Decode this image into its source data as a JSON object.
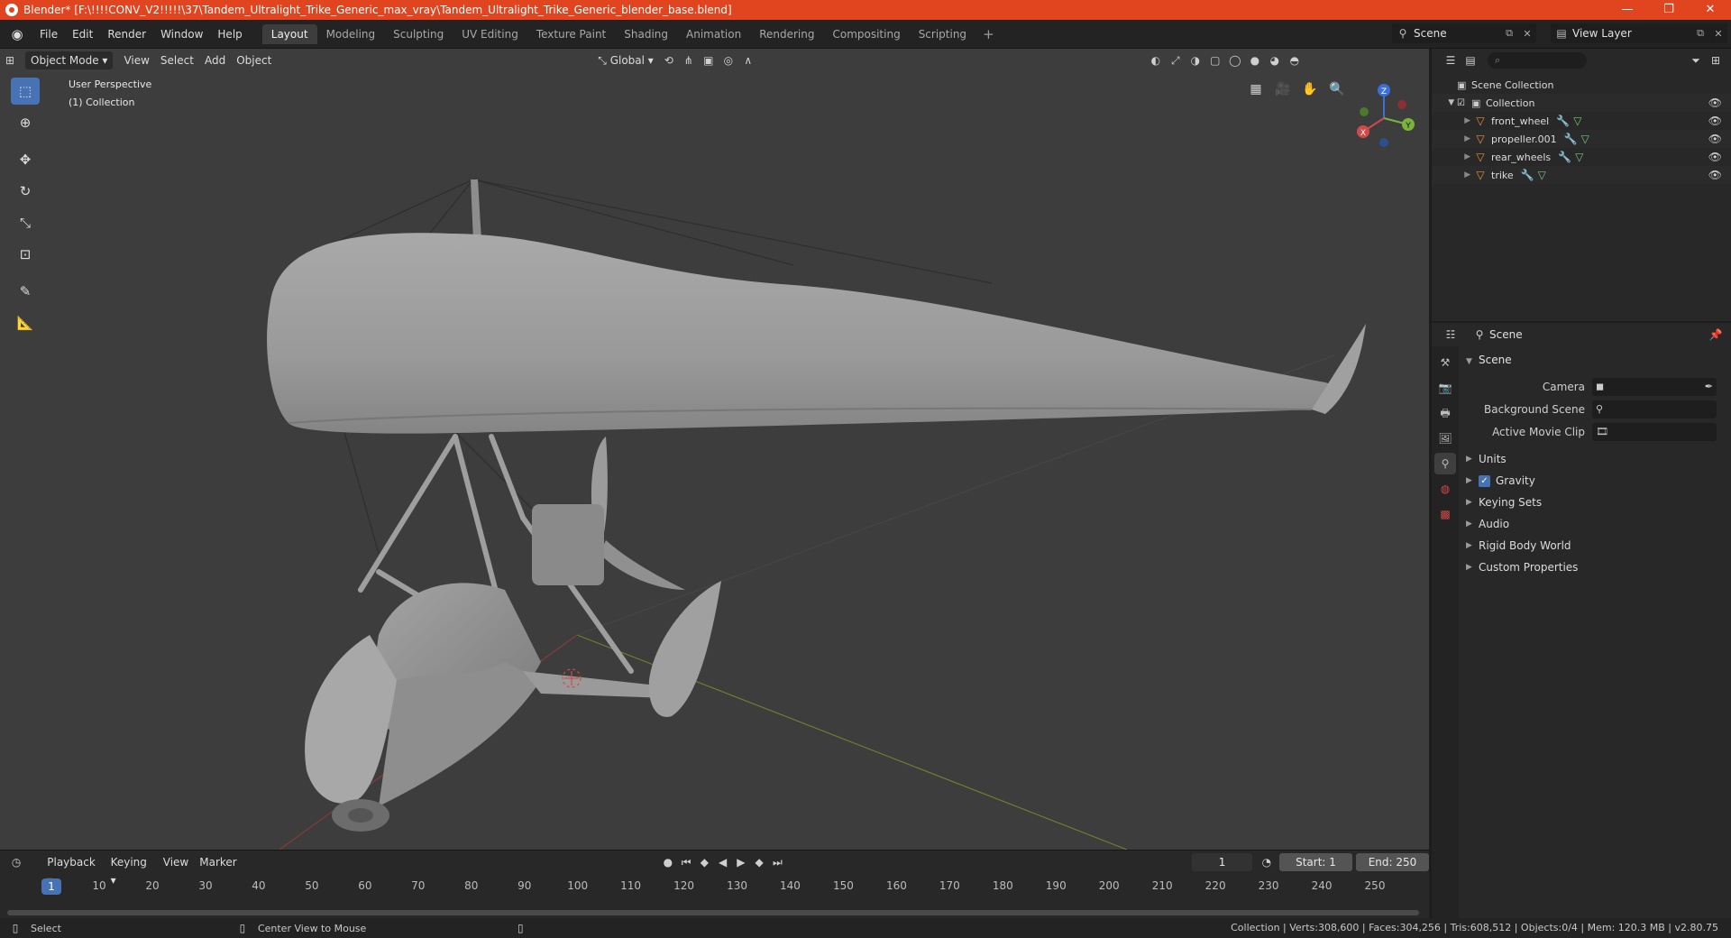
{
  "window": {
    "title": "Blender* [F:\\!!!!CONV_V2!!!!!\\37\\Tandem_Ultralight_Trike_Generic_max_vray\\Tandem_Ultralight_Trike_Generic_blender_base.blend]",
    "controls": [
      "—",
      "❐",
      "✕"
    ]
  },
  "menu": [
    "File",
    "Edit",
    "Render",
    "Window",
    "Help"
  ],
  "workspaces": [
    "Layout",
    "Modeling",
    "Sculpting",
    "UV Editing",
    "Texture Paint",
    "Shading",
    "Animation",
    "Rendering",
    "Compositing",
    "Scripting"
  ],
  "active_workspace": "Layout",
  "scene_name": "Scene",
  "view_layer": "View Layer",
  "viewport": {
    "mode": "Object Mode",
    "menus": [
      "View",
      "Select",
      "Add",
      "Object"
    ],
    "orientation": "Global",
    "info_line1": "User Perspective",
    "info_line2": "(1) Collection",
    "axes": {
      "x": "X",
      "y": "Y",
      "z": "Z"
    }
  },
  "outliner": {
    "root": "Scene Collection",
    "collection": "Collection",
    "objects": [
      "front_wheel",
      "propeller.001",
      "rear_wheels",
      "trike"
    ]
  },
  "properties": {
    "context": "Scene",
    "panel": "Scene",
    "camera_label": "Camera",
    "background_label": "Background Scene",
    "movieclip_label": "Active Movie Clip",
    "subpanels": [
      "Units",
      "Gravity",
      "Keying Sets",
      "Audio",
      "Rigid Body World",
      "Custom Properties"
    ]
  },
  "timeline": {
    "menus": [
      "Playback",
      "Keying",
      "View",
      "Marker"
    ],
    "current_frame": "1",
    "start_label": "Start:",
    "start": "1",
    "end_label": "End:",
    "end": "250",
    "ticks": [
      "10",
      "20",
      "30",
      "40",
      "50",
      "60",
      "70",
      "80",
      "90",
      "100",
      "110",
      "120",
      "130",
      "140",
      "150",
      "160",
      "170",
      "180",
      "190",
      "200",
      "210",
      "220",
      "230",
      "240",
      "250"
    ]
  },
  "status": {
    "left": "Select",
    "middle": "Center View to Mouse",
    "right": "Collection | Verts:308,600 | Faces:304,256 | Tris:608,512 | Objects:0/4 | Mem: 120.3 MB | v2.80.75"
  },
  "colors": {
    "accent": "#4772b3",
    "titlebar": "#e0451f",
    "object_icon": "#e8903a"
  }
}
